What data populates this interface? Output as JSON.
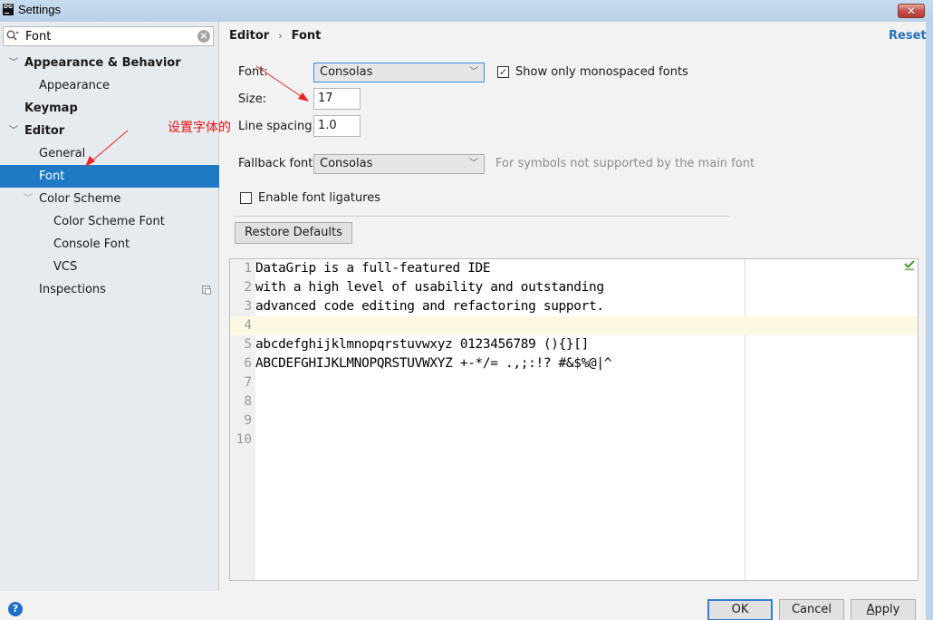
{
  "window": {
    "title": "Settings",
    "app_icon_text": "DG",
    "close_glyph": "✕"
  },
  "sidebar": {
    "search": {
      "value": "Font",
      "placeholder": ""
    },
    "items": [
      {
        "label": "Appearance & Behavior",
        "level": 0,
        "bold": true,
        "expanded": true
      },
      {
        "label": "Appearance",
        "level": 1,
        "bold": false
      },
      {
        "label": "Keymap",
        "level": 0,
        "bold": true
      },
      {
        "label": "Editor",
        "level": 0,
        "bold": true,
        "expanded": true
      },
      {
        "label": "General",
        "level": 1,
        "bold": false
      },
      {
        "label": "Font",
        "level": 1,
        "bold": false,
        "selected": true
      },
      {
        "label": "Color Scheme",
        "level": 1,
        "bold": false,
        "expanded": true
      },
      {
        "label": "Color Scheme Font",
        "level": 2,
        "bold": false
      },
      {
        "label": "Console Font",
        "level": 2,
        "bold": false
      },
      {
        "label": "VCS",
        "level": 2,
        "bold": false
      },
      {
        "label": "Inspections",
        "level": 1,
        "bold": false,
        "has_project_icon": true
      }
    ]
  },
  "header": {
    "breadcrumb": [
      "Editor",
      "Font"
    ],
    "separator": "›",
    "reset_label": "Reset"
  },
  "form": {
    "font_label": "Font:",
    "font_value": "Consolas",
    "show_monospaced_label": "Show only monospaced fonts",
    "show_monospaced_checked": true,
    "size_label": "Size:",
    "size_value": "17",
    "line_spacing_label": "Line spacing:",
    "line_spacing_value": "1.0",
    "fallback_label": "Fallback font:",
    "fallback_value": "Consolas",
    "fallback_hint": "For symbols not supported by the main font",
    "ligatures_label": "Enable font ligatures",
    "ligatures_checked": false,
    "restore_defaults_label": "Restore Defaults"
  },
  "preview": {
    "current_line": 4,
    "lines": [
      {
        "no": "1",
        "text": "DataGrip is a full-featured IDE"
      },
      {
        "no": "2",
        "text": "with a high level of usability and outstanding"
      },
      {
        "no": "3",
        "text": "advanced code editing and refactoring support."
      },
      {
        "no": "4",
        "text": ""
      },
      {
        "no": "5",
        "text": "abcdefghijklmnopqrstuvwxyz 0123456789 (){}[]"
      },
      {
        "no": "6",
        "text": "ABCDEFGHIJKLMNOPQRSTUVWXYZ +-*/= .,;:!? #&$%@|^"
      },
      {
        "no": "7",
        "text": ""
      },
      {
        "no": "8",
        "text": ""
      },
      {
        "no": "9",
        "text": ""
      },
      {
        "no": "10",
        "text": ""
      }
    ]
  },
  "annotation": {
    "text": "设置字体的",
    "color": "#ee1111"
  },
  "footer": {
    "help_glyph": "?",
    "ok_label": "OK",
    "cancel_label": "Cancel",
    "apply_label": "Apply"
  },
  "colors": {
    "selection": "#1f7ac6",
    "link": "#2470c2",
    "current_line": "#fdf8e3"
  }
}
